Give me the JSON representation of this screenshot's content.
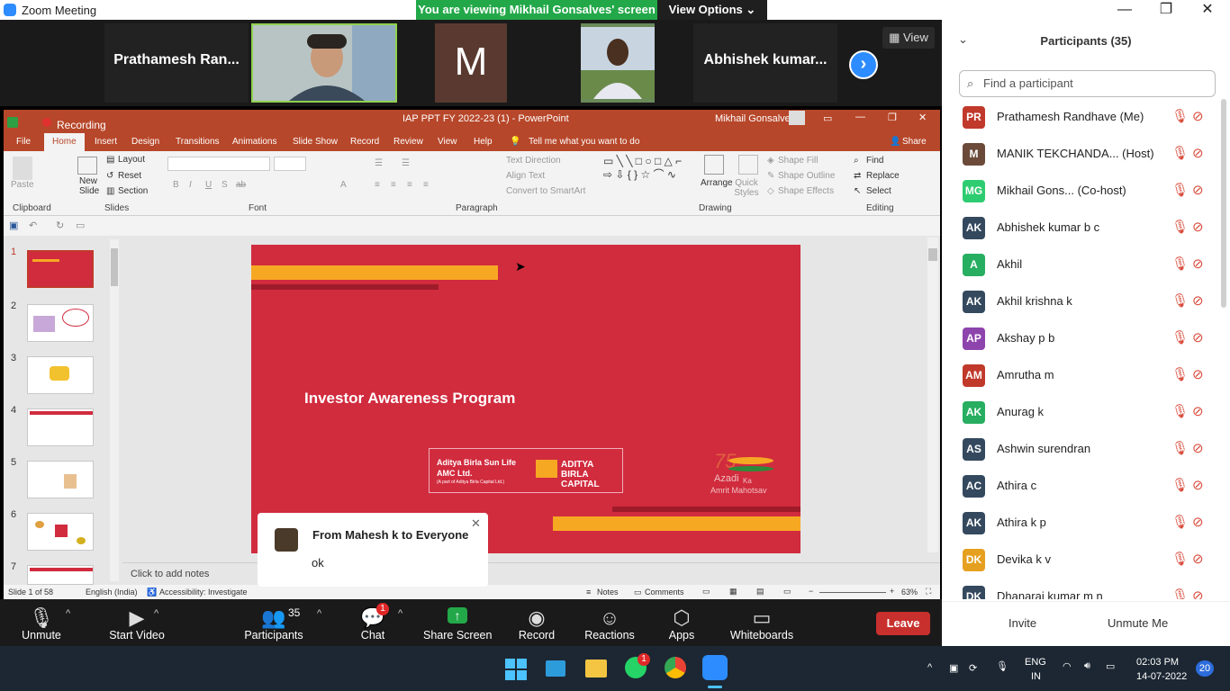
{
  "window": {
    "title": "Zoom Meeting"
  },
  "banner": {
    "text": "You are viewing Mikhail Gonsalves' screen",
    "view_options": "View Options"
  },
  "strip": {
    "tiles": [
      {
        "name": "Prathamesh Ran..."
      },
      {
        "name": ""
      },
      {
        "name": "M"
      },
      {
        "name": ""
      },
      {
        "name": "Abhishek  kumar..."
      }
    ],
    "view_label": "View"
  },
  "ppt": {
    "recording_label": "Recording",
    "file_title": "IAP PPT FY 2022-23 (1)  -  PowerPoint",
    "user": "Mikhail Gonsalves",
    "tabs": [
      "File",
      "Home",
      "Insert",
      "Design",
      "Transitions",
      "Animations",
      "Slide Show",
      "Record",
      "Review",
      "View",
      "Help"
    ],
    "tell_me": "Tell me what you want to do",
    "share": "Share",
    "ribbon": {
      "paste": "Paste",
      "new_slide": "New Slide",
      "layout": "Layout",
      "reset": "Reset",
      "section": "Section",
      "text_direction": "Text Direction",
      "align_text": "Align Text",
      "convert_smartart": "Convert to SmartArt",
      "arrange": "Arrange",
      "quick_styles": "Quick Styles",
      "shape_fill": "Shape Fill",
      "shape_outline": "Shape Outline",
      "shape_effects": "Shape Effects",
      "find": "Find",
      "replace": "Replace",
      "select": "Select",
      "groups": [
        "Clipboard",
        "Slides",
        "Font",
        "Paragraph",
        "Drawing",
        "Editing"
      ]
    },
    "slide_numbers": [
      "1",
      "2",
      "3",
      "4",
      "5",
      "6",
      "7"
    ],
    "slide": {
      "title": "Investor Awareness Program",
      "logo_left_line1": "Aditya Birla Sun Life",
      "logo_left_line2": "AMC Ltd.",
      "logo_left_line3": "(A part of Aditya Birla Capital Ltd.)",
      "logo_right": "ADITYA BIRLA CAPITAL",
      "azadi_line1": "Azadi",
      "azadi_line2": "Amrit Mahotsav",
      "azadi_ka": "Ka"
    },
    "notes_placeholder": "Click to add notes",
    "status": {
      "slide_count": "Slide 1 of 58",
      "language": "English (India)",
      "accessibility": "Accessibility: Investigate",
      "notes": "Notes",
      "comments": "Comments",
      "zoom": "63%"
    }
  },
  "toast": {
    "from": "From Mahesh k to Everyone",
    "message": "ok"
  },
  "toolbar": {
    "unmute": "Unmute",
    "start_video": "Start Video",
    "participants": "Participants",
    "participants_count": "35",
    "chat": "Chat",
    "chat_badge": "1",
    "share_screen": "Share Screen",
    "record": "Record",
    "reactions": "Reactions",
    "apps": "Apps",
    "whiteboards": "Whiteboards",
    "leave": "Leave"
  },
  "panel": {
    "title": "Participants (35)",
    "search_placeholder": "Find a participant",
    "participants": [
      {
        "initials": "PR",
        "name": "Prathamesh Randhave (Me)",
        "color": "#c0392b"
      },
      {
        "initials": "M",
        "name": "MANIK TEKCHANDA... (Host)",
        "color": "#6b4a3a"
      },
      {
        "initials": "MG",
        "name": "Mikhail Gons... (Co-host)",
        "color": "#2ecc71"
      },
      {
        "initials": "AK",
        "name": "Abhishek kumar b c",
        "color": "#34495e"
      },
      {
        "initials": "A",
        "name": "Akhil",
        "color": "#27ae60"
      },
      {
        "initials": "AK",
        "name": "Akhil krishna k",
        "color": "#34495e"
      },
      {
        "initials": "AP",
        "name": "Akshay p b",
        "color": "#8e44ad"
      },
      {
        "initials": "AM",
        "name": "Amrutha m",
        "color": "#c0392b"
      },
      {
        "initials": "AK",
        "name": "Anurag k",
        "color": "#27ae60"
      },
      {
        "initials": "AS",
        "name": "Ashwin surendran",
        "color": "#34495e"
      },
      {
        "initials": "AC",
        "name": "Athira c",
        "color": "#34495e"
      },
      {
        "initials": "AK",
        "name": "Athira k p",
        "color": "#34495e"
      },
      {
        "initials": "DK",
        "name": "Devika k v",
        "color": "#e6a020"
      },
      {
        "initials": "DK",
        "name": "Dhanaraj kumar m n",
        "color": "#34495e"
      }
    ],
    "invite": "Invite",
    "unmute_me": "Unmute Me"
  },
  "taskbar": {
    "whatsapp_badge": "1",
    "lang1": "ENG",
    "lang2": "IN",
    "time": "02:03 PM",
    "date": "14-07-2022",
    "notif_count": "20"
  }
}
